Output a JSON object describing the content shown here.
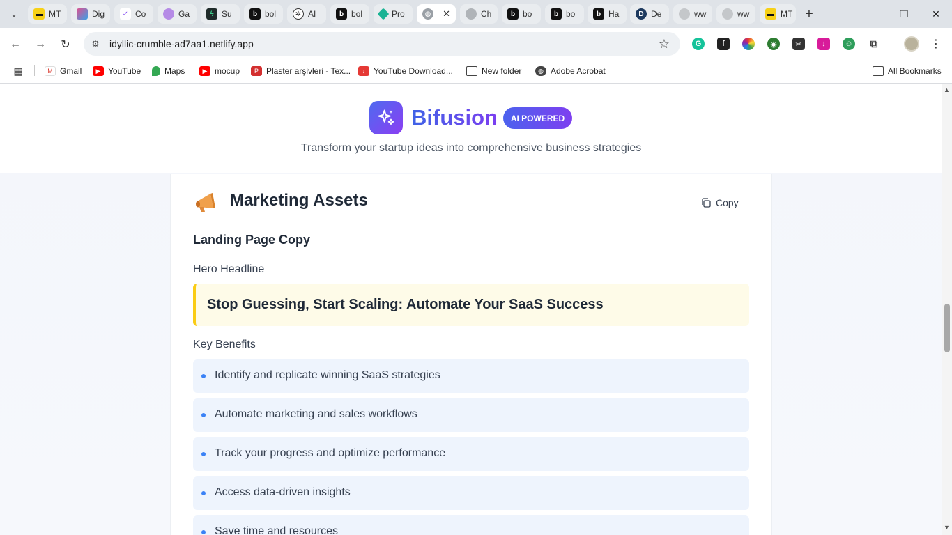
{
  "browser": {
    "tabs": [
      {
        "label": "MT"
      },
      {
        "label": "Dig"
      },
      {
        "label": "Co"
      },
      {
        "label": "Ga"
      },
      {
        "label": "Su"
      },
      {
        "label": "bol"
      },
      {
        "label": "AI"
      },
      {
        "label": "bol"
      },
      {
        "label": "Pro"
      },
      {
        "label": ""
      },
      {
        "label": "Ch"
      },
      {
        "label": "bo"
      },
      {
        "label": "bo"
      },
      {
        "label": "Ha"
      },
      {
        "label": "De"
      },
      {
        "label": "ww"
      },
      {
        "label": "ww"
      },
      {
        "label": "MT"
      }
    ],
    "url": "idyllic-crumble-ad7aa1.netlify.app",
    "bookmarks": {
      "gmail": "Gmail",
      "youtube": "YouTube",
      "maps": "Maps",
      "mocup": "mocup",
      "plaster": "Plaster arşivleri - Tex...",
      "ytdownload": "YouTube Download...",
      "newfolder": "New folder",
      "acrobat": "Adobe Acrobat",
      "all": "All Bookmarks"
    }
  },
  "header": {
    "brand": "Bifusion",
    "badge": "AI POWERED",
    "tagline": "Transform your startup ideas into comprehensive business strategies"
  },
  "section": {
    "title": "Marketing Assets",
    "copy_label": "Copy",
    "subtitle": "Landing Page Copy",
    "hero_label": "Hero Headline",
    "hero_headline": "Stop Guessing, Start Scaling: Automate Your SaaS Success",
    "benefits_label": "Key Benefits",
    "benefits": [
      "Identify and replicate winning SaaS strategies",
      "Automate marketing and sales workflows",
      "Track your progress and optimize performance",
      "Access data-driven insights",
      "Save time and resources"
    ]
  },
  "colors": {
    "brand_start": "#3f63e6",
    "brand_end": "#7b3ef0",
    "headline_accent": "#facc15",
    "bullet": "#3b82f6"
  }
}
